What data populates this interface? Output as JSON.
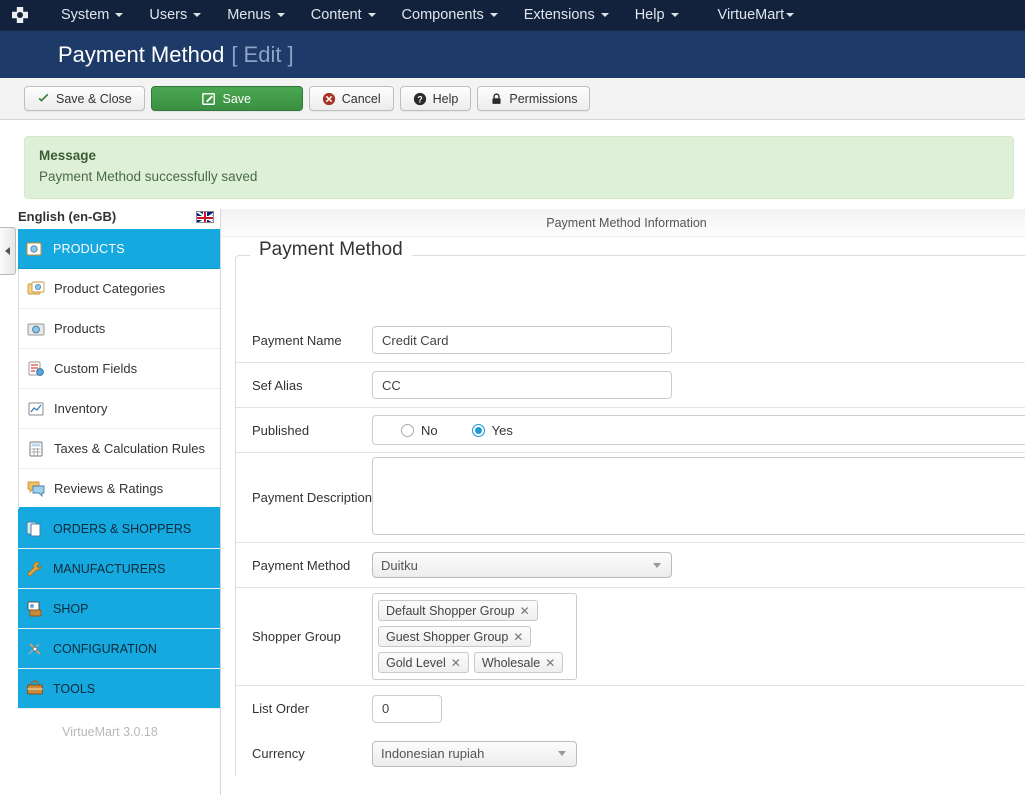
{
  "topnav": {
    "logo_icon": "joomla-logo-icon",
    "items": [
      {
        "label": "System",
        "caret": true
      },
      {
        "label": "Users",
        "caret": true
      },
      {
        "label": "Menus",
        "caret": true
      },
      {
        "label": "Content",
        "caret": true
      },
      {
        "label": "Components",
        "caret": true
      },
      {
        "label": "Extensions",
        "caret": true
      },
      {
        "label": "Help",
        "caret": true
      },
      {
        "label": "VirtueMart",
        "caret": true
      }
    ]
  },
  "titlebar": {
    "title": "Payment Method",
    "subtitle": "[ Edit ]"
  },
  "toolbar": {
    "save_close_label": "Save & Close",
    "save_label": "Save",
    "cancel_label": "Cancel",
    "help_label": "Help",
    "permissions_label": "Permissions",
    "save_button_color": "#3f9b45",
    "cancel_icon_color": "#a93226"
  },
  "alert": {
    "title": "Message",
    "text": "Payment Method successfully saved",
    "bg_color": "#dff0d8",
    "border_color": "#d6e9c6"
  },
  "sidebar": {
    "language": "English (en-GB)",
    "flag_icon": "uk-flag-icon",
    "collapse_icon": "chevron-left-icon",
    "accent_color": "#15a9e0",
    "products_header": {
      "label": "PRODUCTS",
      "icon": "products-icon"
    },
    "product_items": [
      {
        "label": "Product Categories",
        "icon": "categories-icon"
      },
      {
        "label": "Products",
        "icon": "camera-icon"
      },
      {
        "label": "Custom Fields",
        "icon": "custom-fields-icon"
      },
      {
        "label": "Inventory",
        "icon": "inventory-chart-icon"
      },
      {
        "label": "Taxes & Calculation Rules",
        "icon": "calculator-icon"
      },
      {
        "label": "Reviews & Ratings",
        "icon": "speech-bubble-icon"
      }
    ],
    "sections": [
      {
        "label": "ORDERS & SHOPPERS",
        "icon": "orders-icon"
      },
      {
        "label": "MANUFACTURERS",
        "icon": "wrench-icon"
      },
      {
        "label": "SHOP",
        "icon": "shop-icon"
      },
      {
        "label": "CONFIGURATION",
        "icon": "tools-config-icon"
      },
      {
        "label": "TOOLS",
        "icon": "toolbox-icon"
      }
    ],
    "version": "VirtueMart 3.0.18"
  },
  "main": {
    "panel_header": "Payment Method Information",
    "fieldset_legend": "Payment Method",
    "fields": {
      "payment_name": {
        "label": "Payment Name",
        "value": "Credit Card"
      },
      "sef_alias": {
        "label": "Sef Alias",
        "value": "CC"
      },
      "published": {
        "label": "Published",
        "options": [
          {
            "label": "No",
            "selected": false
          },
          {
            "label": "Yes",
            "selected": true
          }
        ],
        "selected_color": "#1f9ad6"
      },
      "payment_description": {
        "label": "Payment Description",
        "value": ""
      },
      "payment_method": {
        "label": "Payment Method",
        "value": "Duitku"
      },
      "shopper_group": {
        "label": "Shopper Group",
        "tags": [
          "Default Shopper Group",
          "Guest Shopper Group",
          "Gold Level",
          "Wholesale"
        ],
        "remove_icon": "close-x-icon"
      },
      "list_order": {
        "label": "List Order",
        "value": "0"
      },
      "currency": {
        "label": "Currency",
        "value": "Indonesian rupiah"
      }
    }
  }
}
